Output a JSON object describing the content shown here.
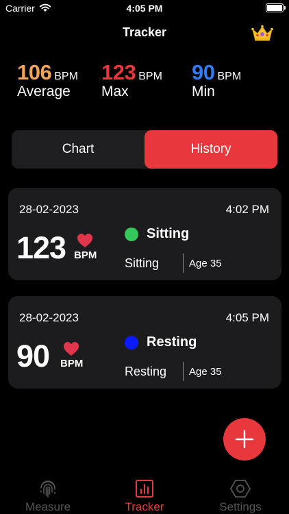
{
  "status_bar": {
    "carrier": "Carrier",
    "time": "4:05 PM"
  },
  "header": {
    "title": "Tracker",
    "premium_icon": "crown-icon"
  },
  "stats": {
    "average": {
      "value": "106",
      "unit": "BPM",
      "label": "Average",
      "color": "#f2a35a"
    },
    "max": {
      "value": "123",
      "unit": "BPM",
      "label": "Max",
      "color": "#e8383d"
    },
    "min": {
      "value": "90",
      "unit": "BPM",
      "label": "Min",
      "color": "#2f7df6"
    }
  },
  "segment": {
    "chart_label": "Chart",
    "history_label": "History",
    "selected": "History"
  },
  "records": [
    {
      "date": "28-02-2023",
      "time": "4:02 PM",
      "bpm": "123",
      "unit": "BPM",
      "state": "Sitting",
      "state_color": "#34c759",
      "activity": "Sitting",
      "age": "Age 35"
    },
    {
      "date": "28-02-2023",
      "time": "4:05 PM",
      "bpm": "90",
      "unit": "BPM",
      "state": "Resting",
      "state_color": "#0a1cff",
      "activity": "Resting",
      "age": "Age 35"
    }
  ],
  "tabs": [
    {
      "label": "Measure",
      "icon": "fingerprint-icon"
    },
    {
      "label": "Tracker",
      "icon": "chart-icon",
      "active": true
    },
    {
      "label": "Settings",
      "icon": "hexagon-gear-icon"
    }
  ],
  "colors": {
    "accent": "#e8383d",
    "card": "#1c1c1e",
    "inactive": "#555555"
  }
}
